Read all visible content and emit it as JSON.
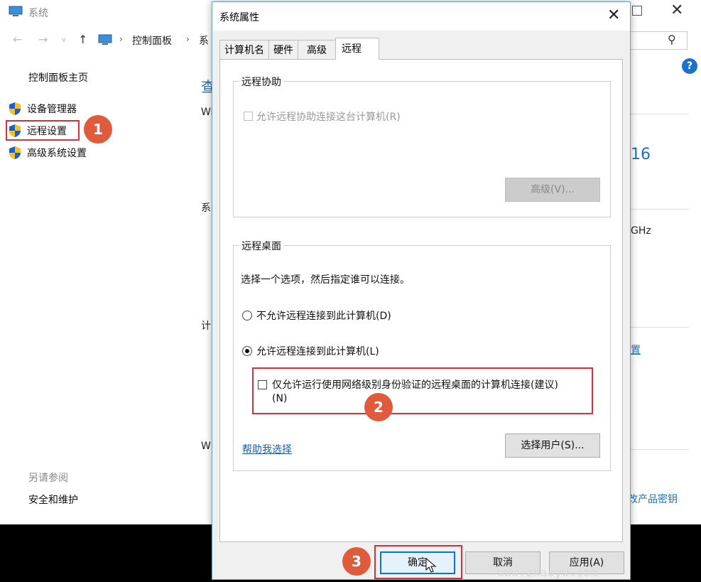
{
  "background_window": {
    "title": "系统",
    "breadcrumb": [
      "控制面板",
      "系"
    ],
    "sidebar": {
      "home": "控制面板主页",
      "items": [
        "设备管理器",
        "远程设置",
        "高级系统设置"
      ],
      "see_also": "另请参阅",
      "security": "安全和维护"
    },
    "fragments": {
      "look": "查",
      "w1": "Wi",
      "num16": "16",
      "sys": "系",
      "ghz": "GHz",
      "comp": "计",
      "settings_link": "置",
      "w2": "W",
      "product_key": "改产品密钥"
    }
  },
  "dialog": {
    "title": "系统属性",
    "tabs": [
      "计算机名",
      "硬件",
      "高级",
      "远程"
    ],
    "active_tab": "远程",
    "remote_assistance": {
      "legend": "远程协助",
      "checkbox_label": "允许远程协助连接这台计算机(R)",
      "advanced_button": "高级(V)..."
    },
    "remote_desktop": {
      "legend": "远程桌面",
      "description": "选择一个选项，然后指定谁可以连接。",
      "option_disallow": "不允许远程连接到此计算机(D)",
      "option_allow": "允许远程连接到此计算机(L)",
      "nla_line1": "仅允许运行使用网络级别身份验证的远程桌面的计算机连接(建议)",
      "nla_line2": "(N)",
      "help_link": "帮助我选择",
      "select_users_button": "选择用户(S)..."
    },
    "buttons": {
      "ok": "确定",
      "cancel": "取消",
      "apply": "应用(A)"
    }
  },
  "badges": [
    "1",
    "2",
    "3"
  ],
  "watermark": "www.zhaoyw.com",
  "colors": {
    "highlight_red": "#d6303a",
    "badge_orange": "#e05a3c",
    "link_blue": "#1a5fb4",
    "accent_blue": "#0078d7"
  }
}
